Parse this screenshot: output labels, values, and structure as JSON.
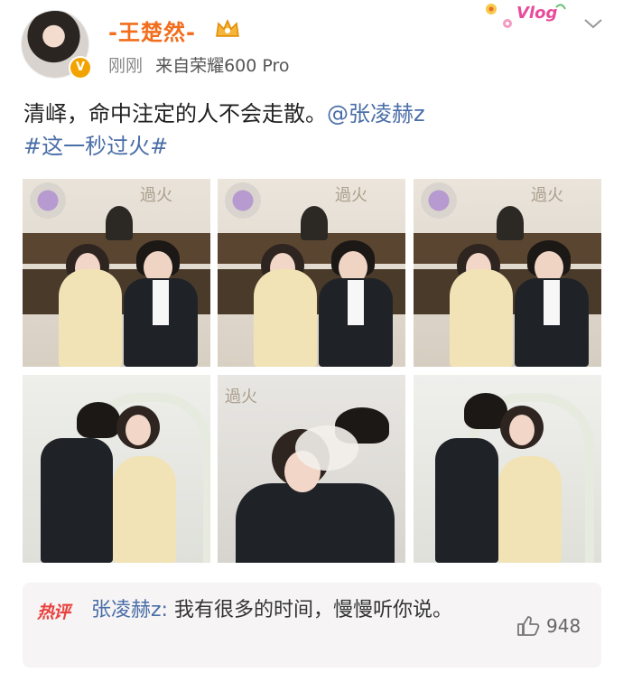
{
  "post": {
    "username": "-王楚然-",
    "time": "刚刚",
    "source_prefix": "来自",
    "source_device": "荣耀600 Pro",
    "vlog_badge": "Vlog",
    "text_main": "清峄，命中注定的人不会走散。",
    "mention": "@张凌赫z",
    "topic": "#这一秒过火#",
    "photo_watermark": "過火"
  },
  "hot_comment": {
    "label": "热评",
    "author": "张凌赫z:",
    "text": "我有很多的时间，慢慢听你说。",
    "likes": "948"
  },
  "colors": {
    "username": "#f26d1c",
    "link": "#4a6ea8",
    "hot_label": "#e8423f"
  }
}
